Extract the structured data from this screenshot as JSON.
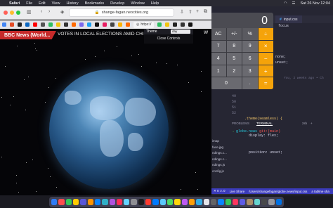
{
  "menubar": {
    "app_name": "Safari",
    "items": [
      "File",
      "Edit",
      "View",
      "History",
      "Bookmarks",
      "Develop",
      "Window",
      "Help"
    ],
    "clock": "Sat 26 Nov 12:04"
  },
  "safari": {
    "url": "shange-fagan.neocities.org",
    "tab_chip": "https://"
  },
  "page": {
    "ticker_label": "BBC News (World...",
    "ticker_text": "VOTES IN LOCAL ELECTIONS AMID CHINA",
    "right_edge_text": "W",
    "theme_label": "Theme",
    "theme_value": "day",
    "close_controls": "Close Controls"
  },
  "calculator": {
    "display": "0",
    "keys": [
      {
        "label": "AC",
        "kind": "fn"
      },
      {
        "label": "+/-",
        "kind": "fn"
      },
      {
        "label": "%",
        "kind": "fn"
      },
      {
        "label": "÷",
        "kind": "op"
      },
      {
        "label": "7",
        "kind": "num"
      },
      {
        "label": "8",
        "kind": "num"
      },
      {
        "label": "9",
        "kind": "num"
      },
      {
        "label": "×",
        "kind": "op"
      },
      {
        "label": "4",
        "kind": "num"
      },
      {
        "label": "5",
        "kind": "num"
      },
      {
        "label": "6",
        "kind": "num"
      },
      {
        "label": "−",
        "kind": "op"
      },
      {
        "label": "1",
        "kind": "num"
      },
      {
        "label": "2",
        "kind": "num"
      },
      {
        "label": "3",
        "kind": "num"
      },
      {
        "label": "+",
        "kind": "op"
      },
      {
        "label": "0",
        "kind": "zero"
      },
      {
        "label": ".",
        "kind": "num"
      },
      {
        "label": "=",
        "kind": "op"
      }
    ]
  },
  "editor": {
    "tab_title": "input.css",
    "focus_word": "focus",
    "none_word": "none;",
    "unset_word": "unset;",
    "ghost_text": "You, 2 weeks ago • Ch",
    "line_numbers": [
      "49",
      "50",
      "51",
      "52"
    ],
    "code_lines": [
      "",
      ".theme(seamless) {",
      "  display: flex;",
      "  position: unset;"
    ],
    "explorer_items": [
      "imap",
      "face.jpg",
      "ndings.c...",
      "ndings.c...",
      "ndings.js",
      "",
      "config.js"
    ],
    "panel_tabs": [
      "PROBLEMS",
      "TERMINAL"
    ],
    "panel_tools": [
      "zsh",
      "+"
    ],
    "terminal_arrow": "→",
    "terminal_path": "globe.news",
    "terminal_git": "git:(main)",
    "status_items": [
      "✕ 0 ⚠ 0",
      "Live Share",
      "/Users/shangefagan/globe.news/input.css",
      "a tabline sha"
    ]
  },
  "colors": {
    "ticker_red": "#c62a2a",
    "calc_orange": "#f5a30a",
    "vscode_status": "#3b3bbb"
  }
}
